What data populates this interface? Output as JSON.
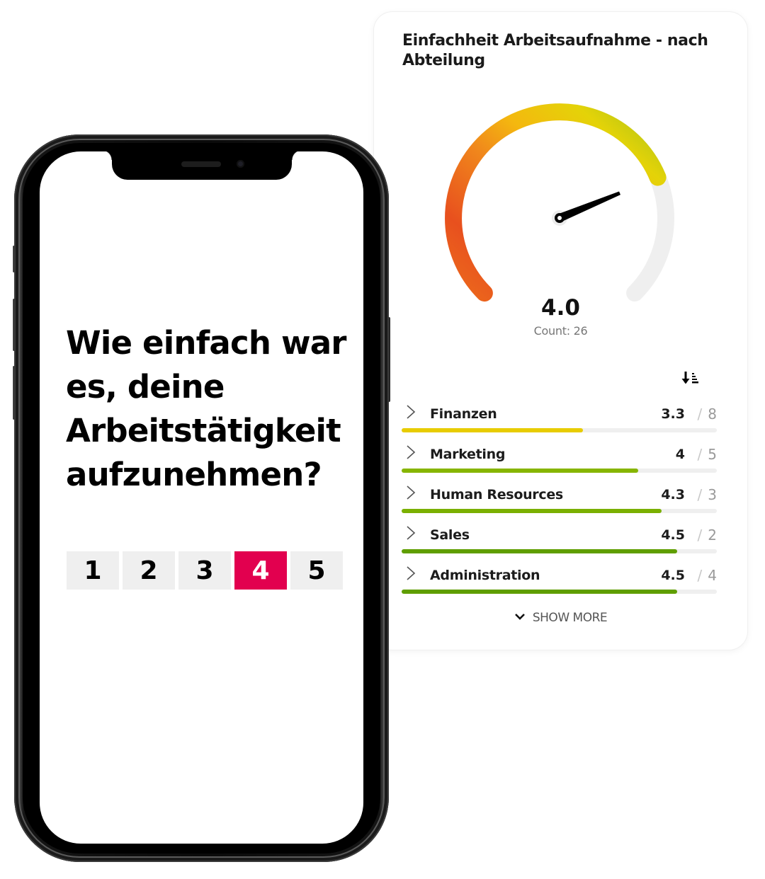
{
  "dashboard": {
    "title": "Einfachheit Arbeitsaufnahme - nach Abteilung",
    "gauge": {
      "value": 4.0,
      "value_label": "4.0",
      "count_label": "Count: 26",
      "min": 1,
      "max": 5,
      "colors": {
        "low": "#e84e1b",
        "mid_low": "#f08a1c",
        "mid": "#f3b90f",
        "mid_high": "#e6d30a",
        "high": "#a9c414",
        "track": "#efefef",
        "needle": "#000000"
      }
    },
    "sort_icon": "sort-descending-icon",
    "departments": [
      {
        "name": "Finanzen",
        "score": 3.3,
        "score_label": "3.3",
        "count_label": "8",
        "color": "#e8cc00"
      },
      {
        "name": "Marketing",
        "score": 4.0,
        "score_label": "4",
        "count_label": "5",
        "color": "#86b500"
      },
      {
        "name": "Human Resources",
        "score": 4.3,
        "score_label": "4.3",
        "count_label": "3",
        "color": "#7ab000"
      },
      {
        "name": "Sales",
        "score": 4.5,
        "score_label": "4.5",
        "count_label": "2",
        "color": "#5f9e00"
      },
      {
        "name": "Administration",
        "score": 4.5,
        "score_label": "4.5",
        "count_label": "4",
        "color": "#5f9e00"
      }
    ],
    "separator": "/",
    "show_more_label": "SHOW MORE"
  },
  "phone": {
    "question": "Wie einfach war es, deine Arbeitstätigkeit aufzunehmen?",
    "scale": [
      {
        "label": "1",
        "selected": false
      },
      {
        "label": "2",
        "selected": false
      },
      {
        "label": "3",
        "selected": false
      },
      {
        "label": "4",
        "selected": true
      },
      {
        "label": "5",
        "selected": false
      }
    ],
    "selected_color": "#e2004f"
  }
}
